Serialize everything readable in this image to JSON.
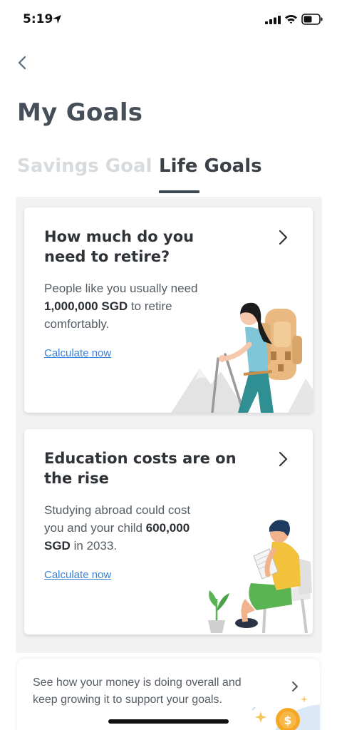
{
  "status_bar": {
    "time": "5:19"
  },
  "header": {
    "title": "My Goals"
  },
  "tabs": [
    {
      "label": "Savings Goal",
      "active": false
    },
    {
      "label": "Life Goals",
      "active": true
    }
  ],
  "cards": [
    {
      "title": "How much do you need to retire?",
      "body_pre": "People like you usually need ",
      "body_bold": "1,000,000 SGD",
      "body_post": " to retire comfortably.",
      "link": "Calculate now"
    },
    {
      "title": "Education costs are on the rise",
      "body_pre": "Studying abroad could cost you and your child ",
      "body_bold": "600,000 SGD",
      "body_post": " in 2033.",
      "link": "Calculate now"
    }
  ],
  "summary": {
    "text": "See how your money is doing overall and keep growing it to support your goals."
  },
  "colors": {
    "link": "#3a82d6",
    "title": "#464f59",
    "inactive_tab": "#d8dbde",
    "backpack": "#e9b981",
    "shirt_teal": "#7fc6d9",
    "shorts_green": "#5bb454",
    "shirt_yellow": "#f2c23c",
    "coin": "#f5a623"
  }
}
